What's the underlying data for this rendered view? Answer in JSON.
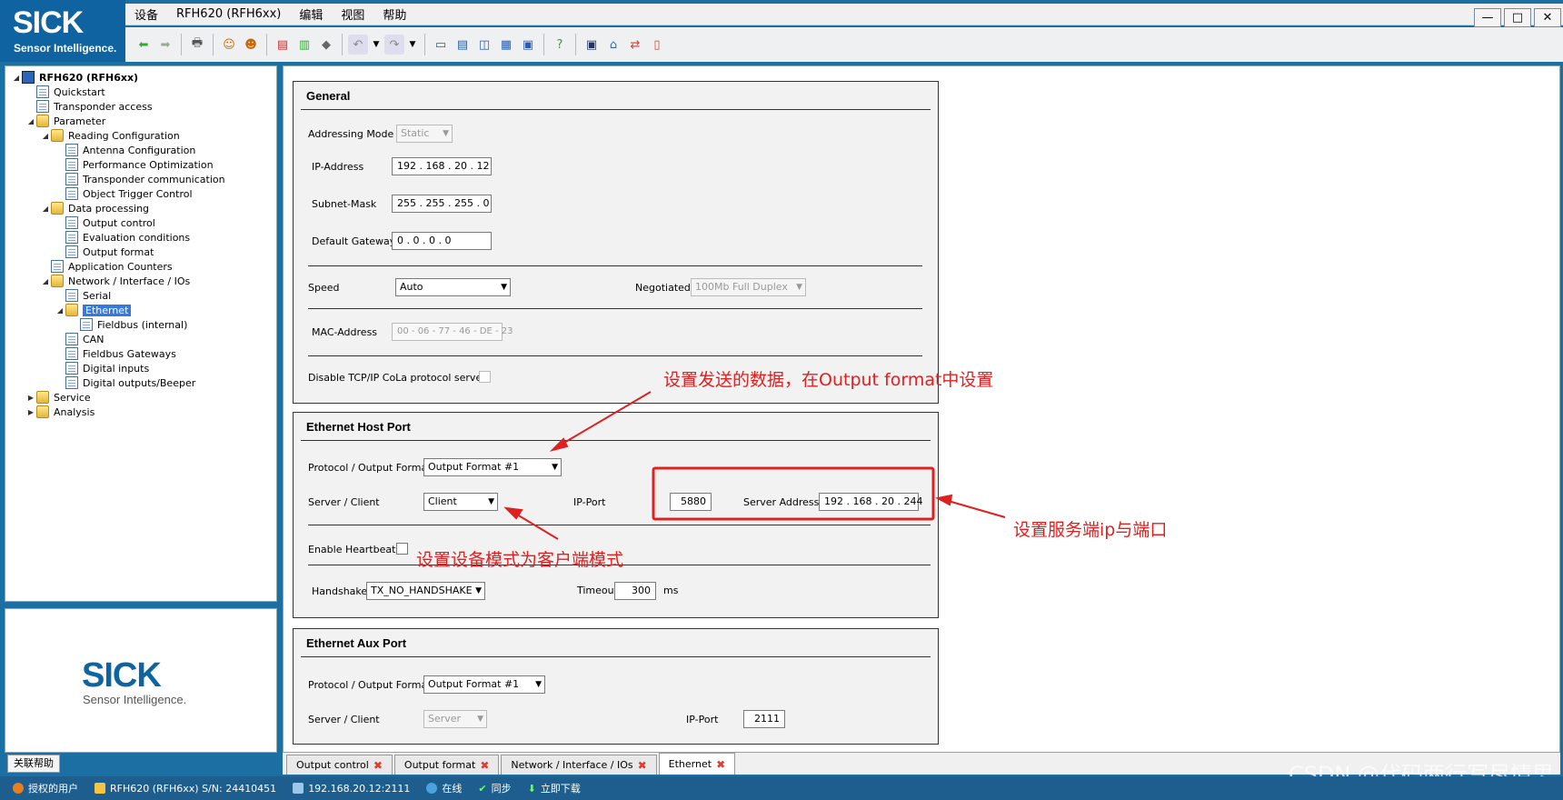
{
  "app": {
    "logo_text": "SICK",
    "logo_tagline": "Sensor Intelligence."
  },
  "menu": [
    "设备",
    "RFH620 (RFH6xx)",
    "编辑",
    "视图",
    "帮助"
  ],
  "window_controls": {
    "minimize": "—",
    "restore": "□",
    "close": "✕"
  },
  "toolbar_icons": [
    "back-arrow-icon",
    "forward-arrow-icon",
    "print-icon",
    "user-login-icon",
    "users-icon",
    "import-icon",
    "export-icon",
    "tag-icon",
    "undo-icon",
    "dropdown-icon",
    "redo-icon",
    "dropdown-icon",
    "layout-1-icon",
    "layout-2-icon",
    "layout-3-icon",
    "layout-4-icon",
    "layout-5-icon",
    "help-icon",
    "monitor-icon",
    "home-icon",
    "transfer-icon",
    "document-icon"
  ],
  "tree": [
    {
      "label": "RFH620 (RFH6xx)",
      "type": "device",
      "level": 0,
      "toggle": "◢",
      "bold": true
    },
    {
      "label": "Quickstart",
      "type": "doc",
      "level": 1,
      "toggle": ""
    },
    {
      "label": "Transponder access",
      "type": "doc",
      "level": 1,
      "toggle": ""
    },
    {
      "label": "Parameter",
      "type": "folder",
      "level": 1,
      "toggle": "◢"
    },
    {
      "label": "Reading Configuration",
      "type": "folder",
      "level": 2,
      "toggle": "◢"
    },
    {
      "label": "Antenna Configuration",
      "type": "doc",
      "level": 3,
      "toggle": ""
    },
    {
      "label": "Performance Optimization",
      "type": "doc",
      "level": 3,
      "toggle": ""
    },
    {
      "label": "Transponder communication",
      "type": "doc",
      "level": 3,
      "toggle": ""
    },
    {
      "label": "Object Trigger Control",
      "type": "doc",
      "level": 3,
      "toggle": ""
    },
    {
      "label": "Data processing",
      "type": "folder",
      "level": 2,
      "toggle": "◢"
    },
    {
      "label": "Output control",
      "type": "doc",
      "level": 3,
      "toggle": ""
    },
    {
      "label": "Evaluation conditions",
      "type": "doc",
      "level": 3,
      "toggle": ""
    },
    {
      "label": "Output format",
      "type": "doc",
      "level": 3,
      "toggle": ""
    },
    {
      "label": "Application Counters",
      "type": "doc",
      "level": 2,
      "toggle": ""
    },
    {
      "label": "Network / Interface / IOs",
      "type": "folder",
      "level": 2,
      "toggle": "◢"
    },
    {
      "label": "Serial",
      "type": "doc",
      "level": 3,
      "toggle": ""
    },
    {
      "label": "Ethernet",
      "type": "folder",
      "level": 3,
      "toggle": "◢",
      "selected": true
    },
    {
      "label": "Fieldbus (internal)",
      "type": "doc",
      "level": 4,
      "toggle": ""
    },
    {
      "label": "CAN",
      "type": "doc",
      "level": 3,
      "toggle": ""
    },
    {
      "label": "Fieldbus Gateways",
      "type": "doc",
      "level": 3,
      "toggle": ""
    },
    {
      "label": "Digital inputs",
      "type": "doc",
      "level": 3,
      "toggle": ""
    },
    {
      "label": "Digital outputs/Beeper",
      "type": "doc",
      "level": 3,
      "toggle": ""
    },
    {
      "label": "Service",
      "type": "folder",
      "level": 1,
      "toggle": "▶"
    },
    {
      "label": "Analysis",
      "type": "folder",
      "level": 1,
      "toggle": "▶"
    }
  ],
  "help_tab": "关联帮助",
  "general": {
    "title": "General",
    "addressing_mode_label": "Addressing Mode",
    "addressing_mode_value": "Static",
    "ip_label": "IP-Address",
    "ip_value": "192 . 168 .  20  .  12",
    "subnet_label": "Subnet-Mask",
    "subnet_value": "255 . 255 . 255 .   0",
    "gateway_label": "Default Gateway",
    "gateway_value": "0   .   0   .   0   .   0",
    "speed_label": "Speed",
    "speed_value": "Auto",
    "negotiated_label": "Negotiated",
    "negotiated_value": "100Mb Full Duplex",
    "mac_label": "MAC-Address",
    "mac_value": "00 - 06 - 77 - 46 - DE - 23",
    "disable_cola_label": "Disable TCP/IP CoLa protocol server"
  },
  "host_port": {
    "title": "Ethernet Host Port",
    "protocol_label": "Protocol / Output Format",
    "protocol_value": "Output Format #1",
    "server_client_label": "Server / Client",
    "server_client_value": "Client",
    "ip_port_label": "IP-Port",
    "ip_port_value": "5880",
    "server_address_label": "Server Address",
    "server_address_value": "192 . 168 .  20  . 244",
    "heartbeat_label": "Enable Heartbeat",
    "handshake_label": "Handshake",
    "handshake_value": "TX_NO_HANDSHAKE",
    "timeout_label": "Timeout",
    "timeout_value": "300",
    "timeout_unit": "ms"
  },
  "aux_port": {
    "title": "Ethernet Aux Port",
    "protocol_label": "Protocol / Output Format",
    "protocol_value": "Output Format #1",
    "server_client_label": "Server / Client",
    "server_client_value": "Server",
    "ip_port_label": "IP-Port",
    "ip_port_value": "2111"
  },
  "annotations": {
    "output_format_note": "设置发送的数据，在Output format中设置",
    "client_mode_note": "设置设备模式为客户端模式",
    "server_ip_note": "设置服务端ip与端口",
    "annotation_color": "#e02020"
  },
  "doc_tabs": [
    {
      "label": "Output control",
      "active": false
    },
    {
      "label": "Output format",
      "active": false
    },
    {
      "label": "Network / Interface / IOs",
      "active": false
    },
    {
      "label": "Ethernet",
      "active": true
    }
  ],
  "status": {
    "user": "授权的用户",
    "device": "RFH620 (RFH6xx) S/N: 24410451",
    "connection": "192.168.20.12:2111",
    "online": "在线",
    "sync": "同步",
    "download": "立即下载"
  },
  "watermark": "CSDN @代码两行写尽情思"
}
